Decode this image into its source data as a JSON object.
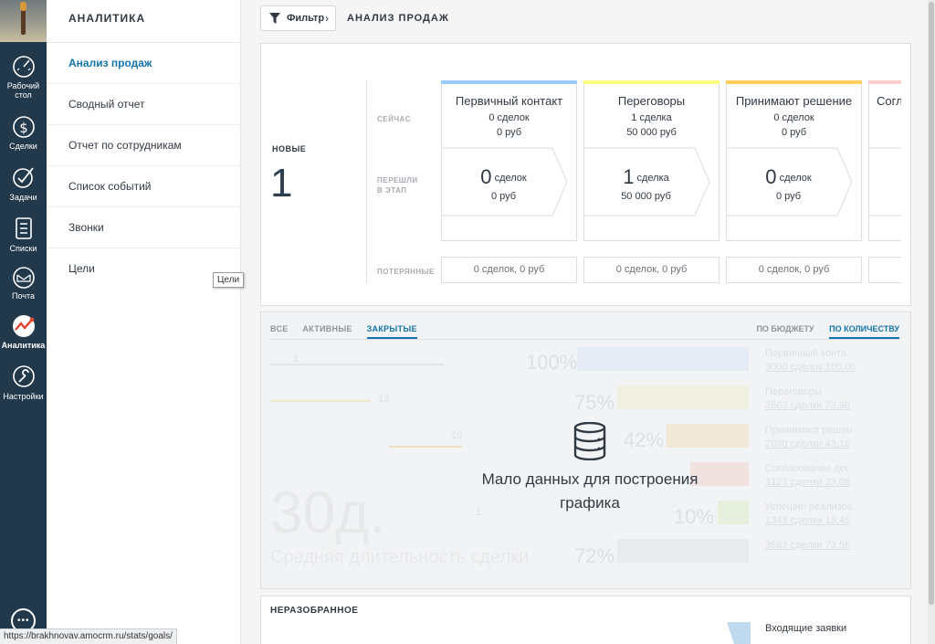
{
  "sidebar": {
    "items": [
      {
        "label": "Рабочий стол",
        "icon": "dashboard-icon"
      },
      {
        "label": "Сделки",
        "icon": "deals-icon"
      },
      {
        "label": "Задачи",
        "icon": "tasks-icon"
      },
      {
        "label": "Списки",
        "icon": "lists-icon"
      },
      {
        "label": "Почта",
        "icon": "mail-icon"
      },
      {
        "label": "Аналитика",
        "icon": "analytics-icon"
      },
      {
        "label": "Настройки",
        "icon": "settings-icon"
      }
    ],
    "active": "Аналитика"
  },
  "menu": {
    "title": "АНАЛИТИКА",
    "items": [
      "Анализ продаж",
      "Сводный отчет",
      "Отчет по сотрудникам",
      "Список событий",
      "Звонки",
      "Цели"
    ],
    "active": "Анализ продаж",
    "tooltip": "Цели"
  },
  "header": {
    "filter_label": "Фильтр",
    "title": "АНАЛИЗ ПРОДАЖ"
  },
  "pipeline": {
    "new_label": "НОВЫЕ",
    "new_count": "1",
    "row_now": "СЕЙЧАС",
    "row_moved_1": "ПЕРЕШЛИ",
    "row_moved_2": "В ЭТАП",
    "row_lost": "ПОТЕРЯННЫЕ",
    "stages": [
      {
        "name": "Первичный контакт",
        "now_deals": "0 сделок",
        "now_sum": "0 руб",
        "moved_count": "0",
        "moved_unit": "сделок",
        "moved_sum": "0 руб",
        "lost": "0 сделок, 0 руб",
        "color": "#99ccfd"
      },
      {
        "name": "Переговоры",
        "now_deals": "1 сделка",
        "now_sum": "50 000 руб",
        "moved_count": "1",
        "moved_unit": "сделка",
        "moved_sum": "50 000 руб",
        "lost": "0 сделок, 0 руб",
        "color": "#fffd7f"
      },
      {
        "name": "Принимают решение",
        "now_deals": "0 сделок",
        "now_sum": "0 руб",
        "moved_count": "0",
        "moved_unit": "сделок",
        "moved_sum": "0 руб",
        "lost": "0 сделок, 0 руб",
        "color": "#ffce5a"
      },
      {
        "name": "Согл",
        "now_deals": "",
        "now_sum": "",
        "moved_count": "",
        "moved_unit": "",
        "moved_sum": "",
        "lost": "",
        "color": "#ffcccc"
      }
    ]
  },
  "chart": {
    "tabs": [
      "ВСЕ",
      "АКТИВНЫЕ",
      "ЗАКРЫТЫЕ"
    ],
    "active_tab": "ЗАКРЫТЫЕ",
    "mode_tabs": [
      "ПО БЮДЖЕТУ",
      "ПО КОЛИЧЕСТВУ"
    ],
    "active_mode": "ПО КОЛИЧЕСТВУ",
    "empty_line1": "Мало данных для построения",
    "empty_line2": "графика",
    "ghost": {
      "big_days": "30д.",
      "avg_label": "Средняя длительность сделки",
      "rows": [
        {
          "pct": "100%",
          "name": "Первичный конта",
          "stat": "3000 сделок 100,00"
        },
        {
          "pct": "75%",
          "name": "Переговоры",
          "stat": "3563 сделки 73,98"
        },
        {
          "pct": "42%",
          "name": "Принимают решен",
          "stat": "2030 сделки 43,16"
        },
        {
          "pct": "",
          "name": "Согласование дог",
          "stat": "3123 сделки 23,08"
        },
        {
          "pct": "10%",
          "name": "Успешно реализов",
          "stat": "1343 сделки 13,45"
        },
        {
          "pct": "72%",
          "name": "",
          "stat": "3683 сделки 73,56"
        }
      ],
      "left_marks": [
        "1",
        "13",
        "10",
        "1"
      ]
    }
  },
  "unsorted": {
    "title": "НЕРАЗОБРАННОЕ",
    "incoming": "Входящие заявки"
  },
  "statusbar": {
    "url": "https://brakhnovav.amocrm.ru/stats/goals/"
  }
}
